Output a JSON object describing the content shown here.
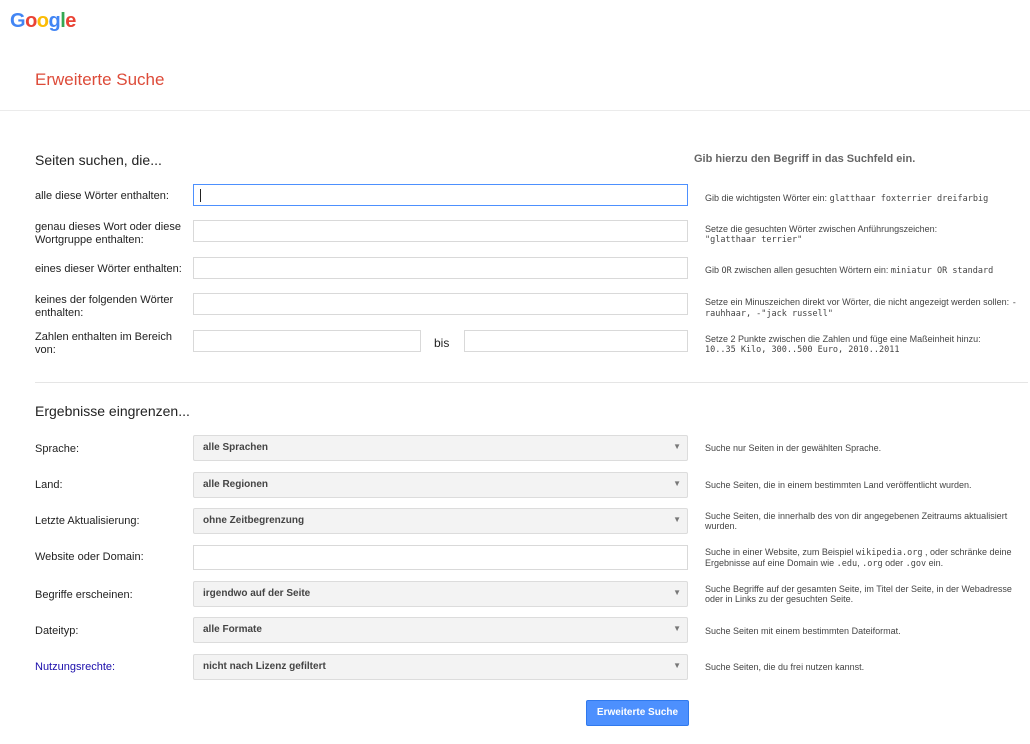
{
  "logo": {
    "letters": [
      "G",
      "o",
      "o",
      "g",
      "l",
      "e"
    ]
  },
  "page_title": "Erweiterte Suche",
  "section1": {
    "title": "Seiten suchen, die...",
    "hint_header": "Gib hierzu den Begriff in das Suchfeld ein.",
    "rows": [
      {
        "label": "alle diese Wörter enthalten:",
        "hint": "Gib die wichtigsten Wörter ein:",
        "hint_code": "glatthaar foxterrier dreifarbig"
      },
      {
        "label": "genau dieses Wort oder diese Wortgruppe enthalten:",
        "hint": "Setze die gesuchten Wörter zwischen Anführungszeichen:",
        "hint_code": "\"glatthaar terrier\""
      },
      {
        "label": "eines dieser Wörter enthalten:",
        "hint_pre": "Gib",
        "hint_or": "OR",
        "hint": "zwischen allen gesuchten Wörtern ein:",
        "hint_code": "miniatur OR standard"
      },
      {
        "label": "keines der folgenden Wörter enthalten:",
        "hint": "Setze ein Minuszeichen direkt vor Wörter, die nicht angezeigt werden sollen:",
        "hint_code": "-rauhhaar, -\"jack russell\""
      },
      {
        "label": "Zahlen enthalten im Bereich von:",
        "bis": "bis",
        "hint": "Setze 2 Punkte zwischen die Zahlen und füge eine Maßeinheit hinzu:",
        "hint_code": "10..35 Kilo, 300..500 Euro, 2010..2011"
      }
    ]
  },
  "section2": {
    "title": "Ergebnisse eingrenzen...",
    "rows": [
      {
        "label": "Sprache:",
        "value": "alle Sprachen",
        "hint": "Suche nur Seiten in der gewählten Sprache."
      },
      {
        "label": "Land:",
        "value": "alle Regionen",
        "hint": "Suche Seiten, die in einem bestimmten Land veröffentlicht wurden."
      },
      {
        "label": "Letzte Aktualisierung:",
        "value": "ohne Zeitbegrenzung",
        "hint": "Suche Seiten, die innerhalb des von dir angegebenen Zeitraums aktualisiert wurden."
      },
      {
        "label": "Website oder Domain:",
        "hint_a": "Suche in einer Website, zum Beispiel",
        "code_a": "wikipedia.org",
        "hint_b": ", oder schränke deine Ergebnisse auf eine Domain wie",
        "code_b": ".edu",
        "sep_b": ",",
        "code_c": ".org",
        "hint_c": "oder",
        "code_d": ".gov",
        "hint_d": "ein."
      },
      {
        "label": "Begriffe erscheinen:",
        "value": "irgendwo auf der Seite",
        "hint": "Suche Begriffe auf der gesamten Seite, im Titel der Seite, in der Webadresse oder in Links zu der gesuchten Seite."
      },
      {
        "label": "Dateityp:",
        "value": "alle Formate",
        "hint": "Suche Seiten mit einem bestimmten Dateiformat."
      },
      {
        "label": "Nutzungsrechte:",
        "value": "nicht nach Lizenz gefiltert",
        "hint": "Suche Seiten, die du frei nutzen kannst."
      }
    ]
  },
  "submit_label": "Erweiterte Suche"
}
